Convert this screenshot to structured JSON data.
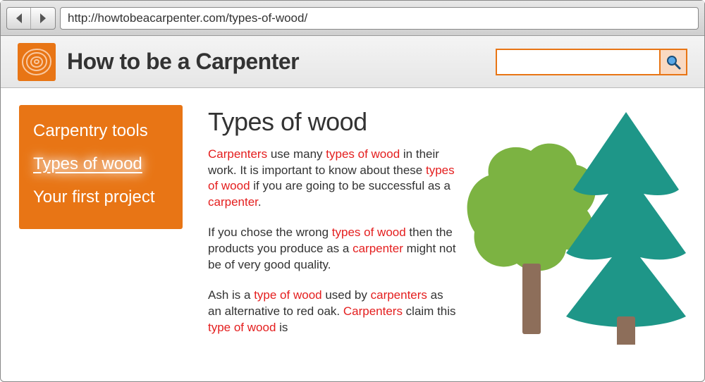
{
  "browser": {
    "url": "http://howtobeacarpenter.com/types-of-wood/"
  },
  "header": {
    "site_title": "How to be a Carpenter",
    "search_placeholder": ""
  },
  "sidebar": {
    "items": [
      {
        "label": "Carpentry tools",
        "active": false
      },
      {
        "label": "Types of wood",
        "active": true
      },
      {
        "label": "Your first project",
        "active": false
      }
    ]
  },
  "article": {
    "title": "Types of wood",
    "keywords": {
      "carpenters": "Carpenters",
      "carpenter": "carpenter",
      "types_of_wood": "types of wood",
      "type_of_wood": "type of wood"
    },
    "p1_t1": " use many ",
    "p1_t2": " in their work. It is important to know about these ",
    "p1_t3": " if you are going to be successful as a ",
    "p1_t4": ".",
    "p2_t1": "If you chose the wrong ",
    "p2_t2": " then the products you produce as a ",
    "p2_t3": " might not be of very good quality.",
    "p3_t1": "Ash is a ",
    "p3_t2": " used by ",
    "p3_t3_carpenters": "carpenters",
    "p3_t4": " as an alternative to red oak. ",
    "p3_t5": " claim this ",
    "p3_t6": " is"
  }
}
